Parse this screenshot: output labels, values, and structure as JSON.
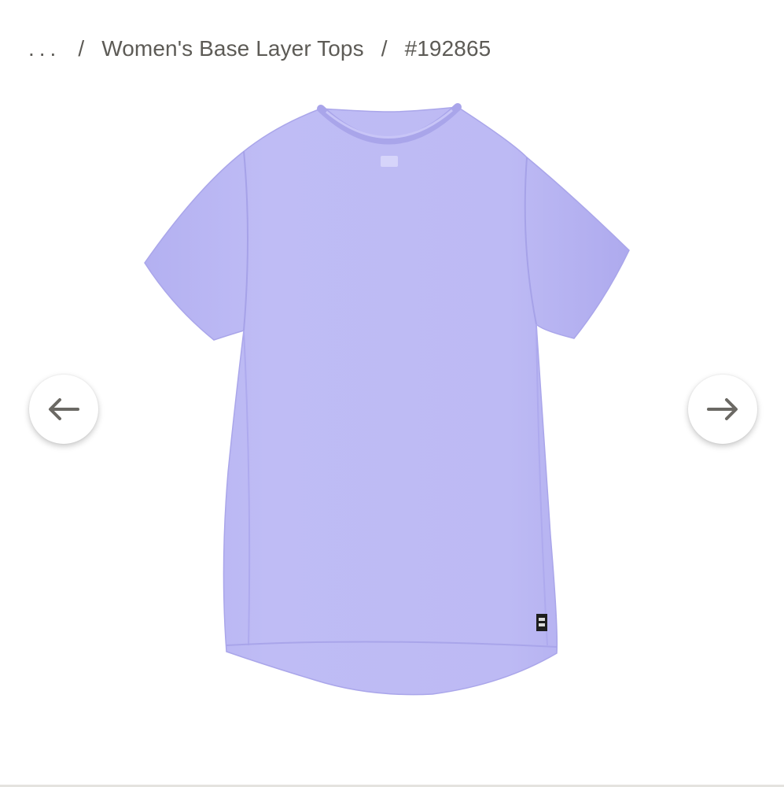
{
  "breadcrumb": {
    "ellipsis": "...",
    "separator": "/",
    "category": "Women's Base Layer Tops",
    "item": "#192865"
  },
  "carousel": {
    "prev_icon": "arrow-left-icon",
    "next_icon": "arrow-right-icon"
  },
  "product": {
    "image_subject": "lavender short-sleeve crew neck t-shirt",
    "shirt_color": "#bcb9f4",
    "shirt_shadow_color": "#a8a4ec",
    "label_tag_color": "#1e1e1e"
  },
  "colors": {
    "breadcrumb_text": "#5d5b56",
    "arrow_icon": "#6b6964",
    "background": "#ffffff"
  }
}
